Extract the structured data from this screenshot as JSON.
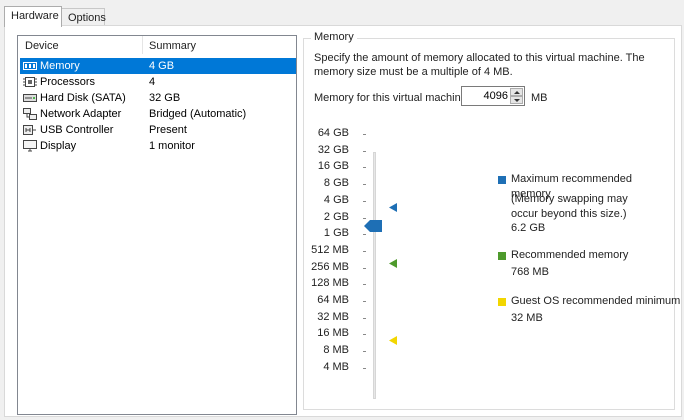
{
  "tabs": [
    {
      "label": "Hardware"
    },
    {
      "label": "Options"
    }
  ],
  "devices": {
    "header": {
      "device": "Device",
      "summary": "Summary"
    },
    "rows": [
      {
        "name": "Memory",
        "summary": "4 GB",
        "icon": "memory-icon"
      },
      {
        "name": "Processors",
        "summary": "4",
        "icon": "processor-icon"
      },
      {
        "name": "Hard Disk (SATA)",
        "summary": "32 GB",
        "icon": "hard-disk-icon"
      },
      {
        "name": "Network Adapter",
        "summary": "Bridged (Automatic)",
        "icon": "network-adapter-icon"
      },
      {
        "name": "USB Controller",
        "summary": "Present",
        "icon": "usb-icon"
      },
      {
        "name": "Display",
        "summary": "1 monitor",
        "icon": "display-icon"
      }
    ],
    "selected": "Memory"
  },
  "memory": {
    "title": "Memory",
    "description": "Specify the amount of memory allocated to this virtual machine. The memory size must be a multiple of 4 MB.",
    "field_label": "Memory for this virtual machine:",
    "value": "4096",
    "unit": "MB",
    "scale": [
      "64 GB",
      "32 GB",
      "16 GB",
      "8 GB",
      "4 GB",
      "2 GB",
      "1 GB",
      "512 MB",
      "256 MB",
      "128 MB",
      "64 MB",
      "32 MB",
      "16 MB",
      "8 MB",
      "4 MB"
    ],
    "slider_value": "4 GB",
    "legend": {
      "maximum": {
        "title": "Maximum recommended memory",
        "note": "(Memory swapping may occur beyond this size.)",
        "value": "6.2 GB",
        "color": "#1e6fb5"
      },
      "recommended": {
        "title": "Recommended memory",
        "value": "768 MB",
        "color": "#4e9a2c"
      },
      "minimum": {
        "title": "Guest OS recommended minimum",
        "value": "32 MB",
        "color": "#f2d600"
      }
    }
  }
}
